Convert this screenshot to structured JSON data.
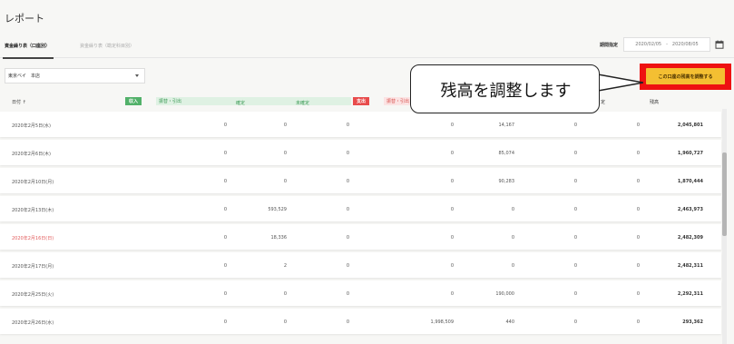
{
  "page": {
    "title": "レポート"
  },
  "tabs": [
    {
      "label": "資金繰り表（口座別）",
      "active": true
    },
    {
      "label": "資金繰り表（勘定科目別）",
      "active": false
    }
  ],
  "period": {
    "label": "期間指定",
    "start": "2020/02/05",
    "separator": "-",
    "end": "2020/08/05"
  },
  "account": {
    "selected": "東京ベイ　本店"
  },
  "adjust_button": {
    "label": "この口座の残高を調整する",
    "highlight_color": "#ee1111",
    "color": "#f4bf32"
  },
  "callout": {
    "text": "残高を調整します"
  },
  "table": {
    "date_header": "日付",
    "income_badge": "収入",
    "income_sub": "振替・引出",
    "confirmed": "確定",
    "unconfirmed": "未確定",
    "expense_badge": "支出",
    "expense_sub": "振替・引出",
    "partial_header": "定",
    "balance_header": "残高",
    "rows": [
      {
        "date": "2020年2月5日(水)",
        "sunday": false,
        "c1": "0",
        "c2": "0",
        "c3": "0",
        "c4": "0",
        "c5": "14,167",
        "c6": "0",
        "c7": "0",
        "balance": "2,045,801"
      },
      {
        "date": "2020年2月6日(木)",
        "sunday": false,
        "c1": "0",
        "c2": "0",
        "c3": "0",
        "c4": "0",
        "c5": "85,074",
        "c6": "0",
        "c7": "0",
        "balance": "1,960,727"
      },
      {
        "date": "2020年2月10日(月)",
        "sunday": false,
        "c1": "0",
        "c2": "0",
        "c3": "0",
        "c4": "0",
        "c5": "90,283",
        "c6": "0",
        "c7": "0",
        "balance": "1,870,444"
      },
      {
        "date": "2020年2月13日(木)",
        "sunday": false,
        "c1": "0",
        "c2": "593,529",
        "c3": "0",
        "c4": "0",
        "c5": "0",
        "c6": "0",
        "c7": "0",
        "balance": "2,463,973"
      },
      {
        "date": "2020年2月16日(日)",
        "sunday": true,
        "c1": "0",
        "c2": "18,336",
        "c3": "0",
        "c4": "0",
        "c5": "0",
        "c6": "0",
        "c7": "0",
        "balance": "2,482,309"
      },
      {
        "date": "2020年2月17日(月)",
        "sunday": false,
        "c1": "0",
        "c2": "2",
        "c3": "0",
        "c4": "0",
        "c5": "0",
        "c6": "0",
        "c7": "0",
        "balance": "2,482,311"
      },
      {
        "date": "2020年2月25日(火)",
        "sunday": false,
        "c1": "0",
        "c2": "0",
        "c3": "0",
        "c4": "0",
        "c5": "190,000",
        "c6": "0",
        "c7": "0",
        "balance": "2,292,311"
      },
      {
        "date": "2020年2月26日(水)",
        "sunday": false,
        "c1": "0",
        "c2": "0",
        "c3": "0",
        "c4": "1,998,509",
        "c5": "440",
        "c6": "0",
        "c7": "0",
        "balance": "293,362"
      }
    ]
  }
}
